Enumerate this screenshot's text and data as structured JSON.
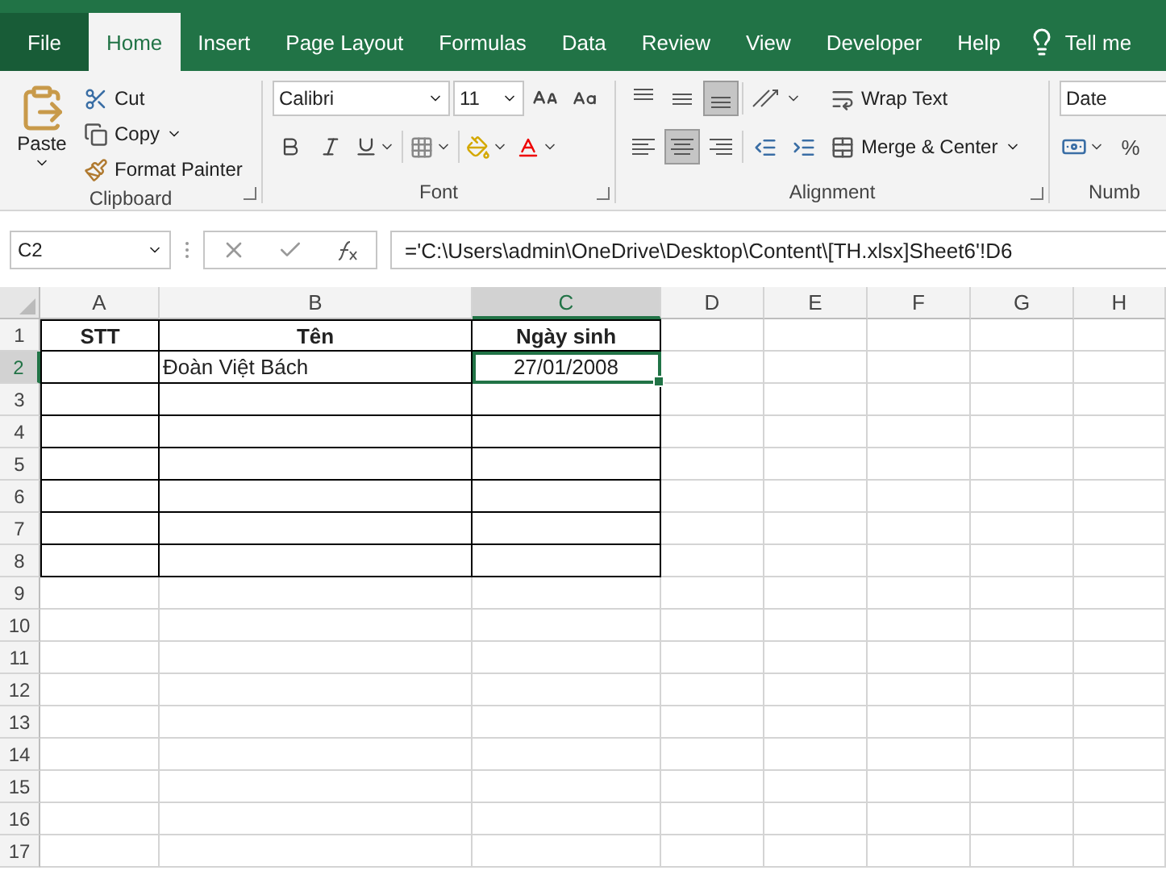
{
  "tabs": [
    {
      "label": "File",
      "selected": false,
      "kind": "file"
    },
    {
      "label": "Home",
      "selected": true,
      "kind": "tab"
    },
    {
      "label": "Insert",
      "selected": false,
      "kind": "tab"
    },
    {
      "label": "Page Layout",
      "selected": false,
      "kind": "tab"
    },
    {
      "label": "Formulas",
      "selected": false,
      "kind": "tab"
    },
    {
      "label": "Data",
      "selected": false,
      "kind": "tab"
    },
    {
      "label": "Review",
      "selected": false,
      "kind": "tab"
    },
    {
      "label": "View",
      "selected": false,
      "kind": "tab"
    },
    {
      "label": "Developer",
      "selected": false,
      "kind": "tab"
    },
    {
      "label": "Help",
      "selected": false,
      "kind": "tab"
    },
    {
      "label": "Tell me",
      "selected": false,
      "kind": "search"
    }
  ],
  "ribbon": {
    "clipboard": {
      "label": "Clipboard",
      "paste": "Paste",
      "cut": "Cut",
      "copy": "Copy",
      "format_painter": "Format Painter"
    },
    "font": {
      "label": "Font",
      "font_name": "Calibri",
      "font_size": "11"
    },
    "alignment": {
      "label": "Alignment",
      "vertical": [
        {
          "kind": "top",
          "selected": false
        },
        {
          "kind": "middle",
          "selected": false
        },
        {
          "kind": "bottom",
          "selected": true
        }
      ],
      "horizontal": [
        {
          "kind": "left",
          "selected": false
        },
        {
          "kind": "center",
          "selected": true
        },
        {
          "kind": "right",
          "selected": false
        }
      ],
      "wrap_text": "Wrap Text",
      "merge_center": "Merge & Center"
    },
    "number": {
      "label": "Numb",
      "format": "Date",
      "percent": "%"
    }
  },
  "formula_bar": {
    "name_box": "C2",
    "formula": "='C:\\Users\\admin\\OneDrive\\Desktop\\Content\\[TH.xlsx]Sheet6'!D6"
  },
  "sheet": {
    "columns": [
      {
        "label": "A",
        "selected": false
      },
      {
        "label": "B",
        "selected": false
      },
      {
        "label": "C",
        "selected": true
      },
      {
        "label": "D",
        "selected": false
      },
      {
        "label": "E",
        "selected": false
      },
      {
        "label": "F",
        "selected": false
      },
      {
        "label": "G",
        "selected": false
      },
      {
        "label": "H",
        "selected": false
      }
    ],
    "rows": [
      {
        "label": "1",
        "selected": false,
        "bordered": true,
        "cells": [
          {
            "text": "STT",
            "kind": "heading",
            "active": false
          },
          {
            "text": "Tên",
            "kind": "heading",
            "active": false
          },
          {
            "text": "Ngày sinh",
            "kind": "heading",
            "active": false
          }
        ]
      },
      {
        "label": "2",
        "selected": true,
        "bordered": true,
        "cells": [
          {
            "kind": "empty",
            "active": false
          },
          {
            "text": "Đoàn Việt Bách",
            "kind": "text",
            "active": false
          },
          {
            "text": "27/01/2008",
            "kind": "date",
            "active": true
          }
        ]
      },
      {
        "label": "3",
        "selected": false,
        "bordered": true
      },
      {
        "label": "4",
        "selected": false,
        "bordered": true
      },
      {
        "label": "5",
        "selected": false,
        "bordered": true
      },
      {
        "label": "6",
        "selected": false,
        "bordered": true
      },
      {
        "label": "7",
        "selected": false,
        "bordered": true
      },
      {
        "label": "8",
        "selected": false,
        "bordered": true
      },
      {
        "label": "9",
        "selected": false,
        "bordered": false
      },
      {
        "label": "10",
        "selected": false,
        "bordered": false
      },
      {
        "label": "11",
        "selected": false,
        "bordered": false
      },
      {
        "label": "12",
        "selected": false,
        "bordered": false
      },
      {
        "label": "13",
        "selected": false,
        "bordered": false
      },
      {
        "label": "14",
        "selected": false,
        "bordered": false
      },
      {
        "label": "15",
        "selected": false,
        "bordered": false
      },
      {
        "label": "16",
        "selected": false,
        "bordered": false
      },
      {
        "label": "17",
        "selected": false,
        "bordered": false
      }
    ]
  }
}
